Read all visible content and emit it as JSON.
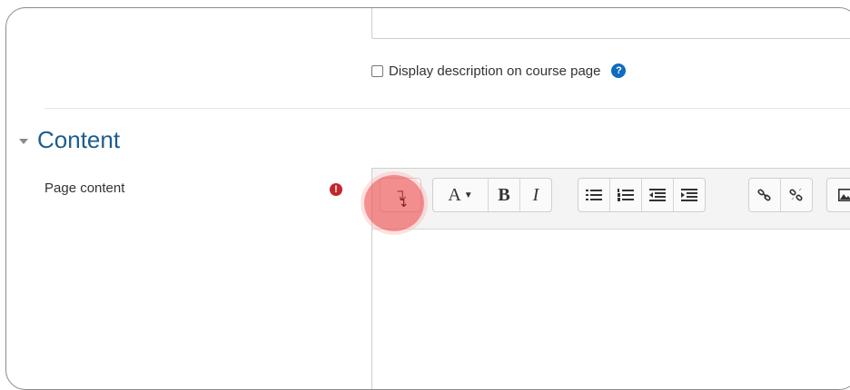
{
  "form": {
    "display_description_label": "Display description on course page",
    "help_icon_glyph": "?",
    "section_title": "Content",
    "page_content_label": "Page content",
    "required_icon_glyph": "!"
  },
  "editor": {
    "toolbar": {
      "toggle_glyph": "↴",
      "font_size_label": "A",
      "font_size_caret": "▼",
      "bold_label": "B",
      "italic_label": "I",
      "icons": [
        "unordered-list-icon",
        "ordered-list-icon",
        "outdent-icon",
        "indent-icon",
        "link-icon",
        "unlink-icon",
        "image-icon"
      ]
    }
  },
  "colors": {
    "help_icon": "#0f6cbf",
    "required_icon": "#c2272d",
    "section_title": "#1d5c8f",
    "click_marker": "#f05555"
  }
}
